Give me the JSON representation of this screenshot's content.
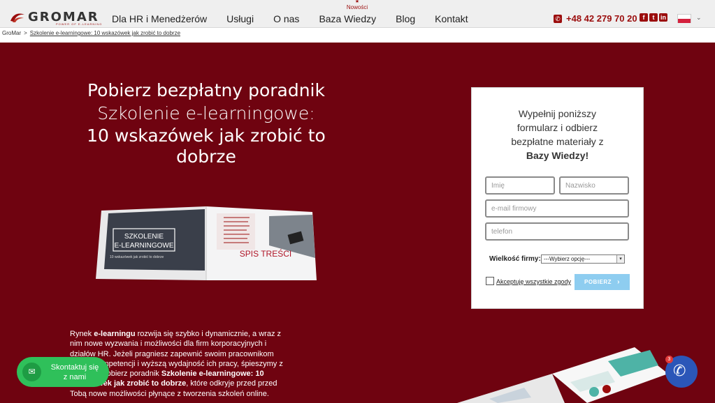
{
  "topbar": {
    "news_label": "Nowości",
    "logo_text": "GROMAR",
    "logo_sub": "POWER OF E-LEARNING",
    "nav": [
      "Dla HR i Menedżerów",
      "Usługi",
      "O nas",
      "Baza Wiedzy",
      "Blog",
      "Kontakt"
    ],
    "phone": "+48 42 279 70 20",
    "socials": [
      "facebook-icon",
      "twitter-icon",
      "linkedin-icon"
    ],
    "language": "PL",
    "accent": "#9b0d0d"
  },
  "breadcrumb": {
    "home": "GroMar",
    "separator": ">",
    "current": "Szkolenie e-learningowe: 10 wskazówek jak zrobić to dobrze"
  },
  "hero": {
    "bg": "#6f0310",
    "title_line1": "Pobierz bezpłatny poradnik",
    "title_line2": "Szkolenie e-learningowe:",
    "title_line3": "10 wskazówek jak zrobić to dobrze",
    "book_cover": {
      "title_line1": "SZKOLENIE",
      "title_line2": "E-LEARNINGOWE",
      "subtitle": "10 wskazówek jak zrobić to dobrze",
      "toc": "SPIS TREŚCI"
    }
  },
  "form": {
    "heading_line1": "Wypełnij poniższy",
    "heading_line2": "formularz i odbierz",
    "heading_line3": "bezpłatne materiały z",
    "heading_bold": "Bazy Wiedzy!",
    "first_name_placeholder": "Imię",
    "last_name_placeholder": "Nazwisko",
    "email_placeholder": "e-mail firmowy",
    "phone_placeholder": "telefon",
    "company_size_label": "Wielkość firmy:",
    "company_size_selected": "---Wybierz opcję---",
    "consent_label": "Akceptuję wszystkie zgody",
    "consent_checked": false,
    "submit_label": "POBIERZ"
  },
  "content": {
    "p1_prefix": "Rynek ",
    "p1_bold": "e-learningu",
    "p1_rest": " rozwija się szybko i dynamicznie, a wraz z nim nowe wyzwania i możliwości dla firm korporacyjnych i działów HR. Jeżeli pragniesz zapewnić swoim pracownikom rozwój kompetencji i wyższą wydajność ich pracy, śpieszymy z pomocą. Pobierz poradnik ",
    "p1_bold2": "Szkolenie e-learningowe: 10 wskazówek jak zrobić to dobrze",
    "p1_end": ", które odkryje przed przed Tobą nowe możliwości płynące z tworzenia szkoleń online."
  },
  "widgets": {
    "contact_line1": "Skontaktuj się",
    "contact_line2": "z nami",
    "call_badge": "3"
  }
}
